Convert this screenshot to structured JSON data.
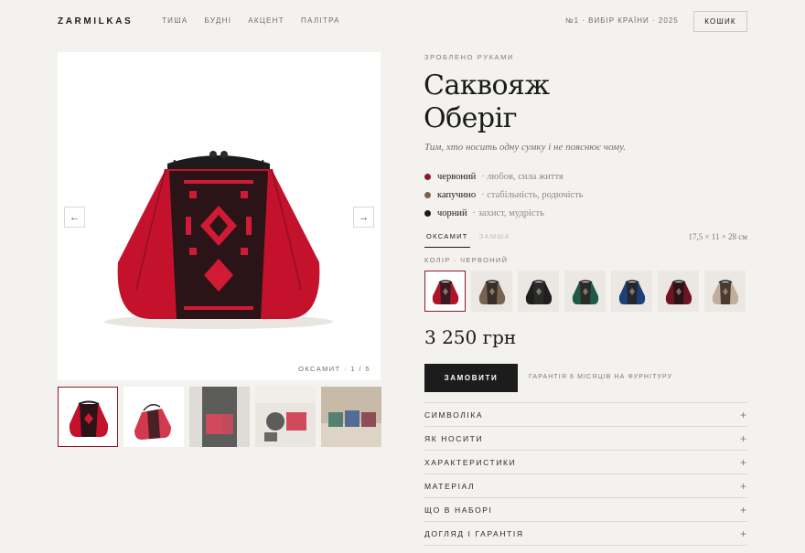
{
  "header": {
    "brand": "ZARMILKAS",
    "nav": [
      "ТИША",
      "БУДНІ",
      "АКЦЕНТ",
      "ПАЛІТРА"
    ],
    "award": "№1 · ВИБІР КРАЇНИ · 2025",
    "cart_label": "КОШИК"
  },
  "gallery": {
    "counter": "ОКСАМИТ · 1 / 5",
    "prev_icon": "←",
    "next_icon": "→"
  },
  "product": {
    "eyebrow": "ЗРОБЛЕНО РУКАМИ",
    "title_line1": "Саквояж",
    "title_line2": "Оберіг",
    "subtitle": "Тим, хто носить одну сумку і не пояснює чому.",
    "meanings": [
      {
        "name": "червоний",
        "desc": "· любов, сила життя",
        "color": "#8b1a2a"
      },
      {
        "name": "капучино",
        "desc": "· стабільність, родючість",
        "color": "#7a6250"
      },
      {
        "name": "чорний",
        "desc": "· захист, мудрість",
        "color": "#1a1a1a"
      }
    ],
    "tabs": [
      {
        "label": "ОКСАМИТ",
        "active": true
      },
      {
        "label": "ЗАМША",
        "active": false
      }
    ],
    "size": "17,5 × 11 × 28 см",
    "color_label": "КОЛІР · ЧЕРВОНИЙ",
    "swatches": [
      {
        "body": "#b0142a",
        "panel": "#3a1a20",
        "active": true
      },
      {
        "body": "#7a6250",
        "panel": "#3a2f28",
        "active": false
      },
      {
        "body": "#1e1e1e",
        "panel": "#2a2a2a",
        "active": false
      },
      {
        "body": "#1f5a48",
        "panel": "#2a2a28",
        "active": false
      },
      {
        "body": "#1f3f78",
        "panel": "#26262e",
        "active": false
      },
      {
        "body": "#6e1424",
        "panel": "#2a1418",
        "active": false
      },
      {
        "body": "#bfae9c",
        "panel": "#4a3a30",
        "active": false
      }
    ],
    "price": "3 250 грн",
    "order_label": "ЗАМОВИТИ",
    "warranty": "ГАРАНТІЯ 6 МІСЯЦІВ НА ФУРНІТУРУ",
    "accordion": [
      "СИМВОЛІКА",
      "ЯК НОСИТИ",
      "ХАРАКТЕРИСТИКИ",
      "МАТЕРІАЛ",
      "ЩО В НАБОРІ",
      "ДОГЛЯД І ГАРАНТІЯ"
    ],
    "plus_icon": "+"
  }
}
